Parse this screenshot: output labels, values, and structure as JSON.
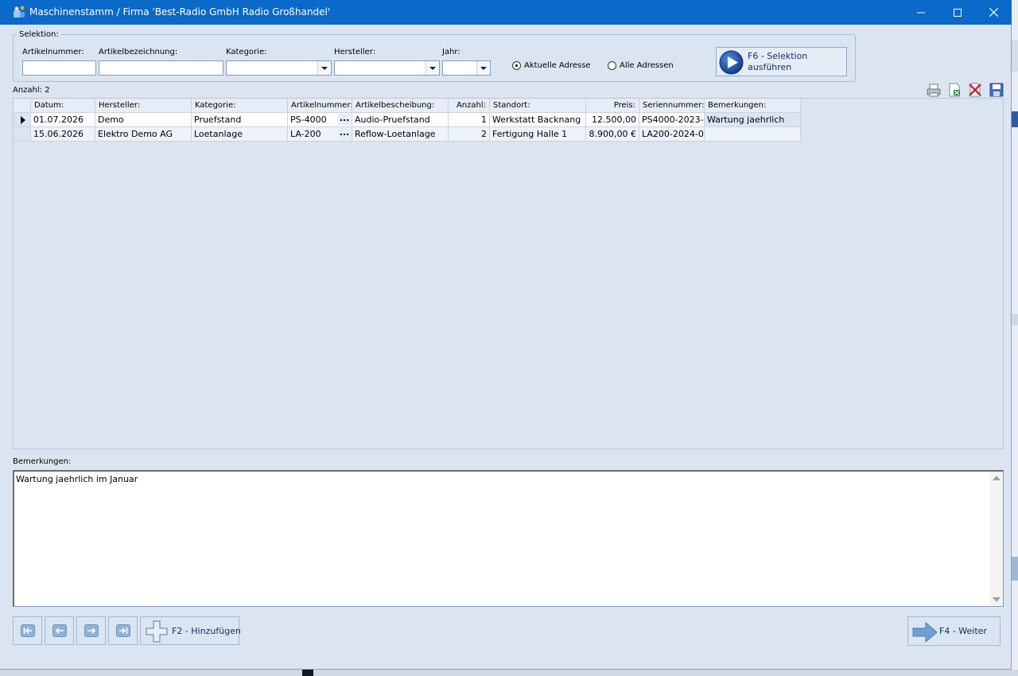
{
  "window": {
    "title": "Maschinenstamm / Firma 'Best-Radio GmbH Radio Großhandel'",
    "minimize_glyph": "—",
    "maximize_glyph": "☐",
    "close_glyph": "✕"
  },
  "selection": {
    "legend": "Selektion:",
    "artikelnummer": {
      "label": "Artikelnummer:",
      "value": ""
    },
    "artikelbezeichnung": {
      "label": "Artikelbezeichnung:",
      "value": ""
    },
    "kategorie": {
      "label": "Kategorie:",
      "value": ""
    },
    "hersteller": {
      "label": "Hersteller:",
      "value": ""
    },
    "jahr": {
      "label": "Jahr:",
      "value": ""
    },
    "radio_current": "Aktuelle Adresse",
    "radio_all": "Alle Adressen",
    "selected_radio": "current",
    "run_button": "F6 - Selektion\nausführen"
  },
  "count_text": "Anzahl: 2",
  "toolbar_icons": [
    "printer-icon",
    "excel-export-icon",
    "delete-icon",
    "save-icon"
  ],
  "grid": {
    "columns": [
      "Datum:",
      "Hersteller:",
      "Kategorie:",
      "Artikelnummer:",
      "Artikelbescheibung:",
      "Anzahl:",
      "Standort:",
      "Preis:",
      "Seriennummer:",
      "Bemerkungen:"
    ],
    "rows": [
      {
        "datum": "01.07.2026",
        "hersteller": "Demo",
        "kategorie": "Pruefstand",
        "artikelnummer": "PS-4000",
        "artikelbeschreibung": "Audio-Pruefstand",
        "anzahl": "1",
        "standort": "Werkstatt Backnang",
        "preis": "12.500,00",
        "seriennummer": "PS4000-2023-",
        "bemerkungen": "Wartung jaehrlich"
      },
      {
        "datum": "15.06.2026",
        "hersteller": "Elektro Demo AG",
        "kategorie": "Loetanlage",
        "artikelnummer": "LA-200",
        "artikelbeschreibung": "Reflow-Loetanlage",
        "anzahl": "2",
        "standort": "Fertigung Halle 1",
        "preis": "8.900,00 €",
        "seriennummer": "LA200-2024-0",
        "bemerkungen": ""
      }
    ],
    "ellipsis": "..."
  },
  "remarks": {
    "label": "Bemerkungen:",
    "text": "Wartung jaehrlich im Januar"
  },
  "footer": {
    "first_icon": "first-record-icon",
    "prev_icon": "previous-record-icon",
    "next_icon": "next-record-icon",
    "last_icon": "last-record-icon",
    "add_button": "F2 - Hinzufügen",
    "next_button": "F4 - Weiter"
  },
  "colors": {
    "titlebar": "#0a69c9",
    "window_bg": "#dbe5f1",
    "accent_button": "#8fb2d8"
  }
}
